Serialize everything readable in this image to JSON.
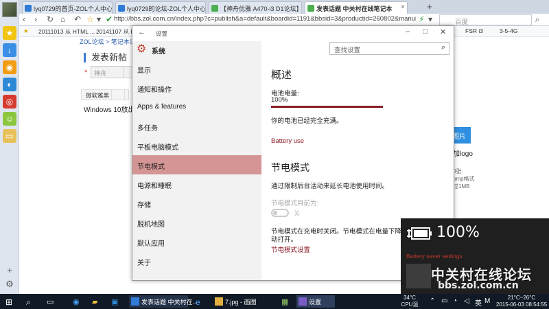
{
  "browser": {
    "tabs": [
      {
        "title": "lyq0729的首页-ZOL个人中心"
      },
      {
        "title": "lyq0729的论坛-ZOL个人中心"
      },
      {
        "title": "【神舟优雅 A470-i3 D1论坛】"
      },
      {
        "title": "发表话题 中关村在线笔记本"
      }
    ],
    "new_tab": "+",
    "url": "http://bbs.zol.com.cn/index.php?c=publish&a=default&boardid=1191&bbsid=3&productid=260802&manuid",
    "search_placeholder": "百度",
    "bookmarks": [
      "20111013 从 HTML ...",
      "20141107 从 IE",
      "FSR i3",
      "3-5-4G"
    ],
    "page": {
      "breadcrumb": "ZOL论坛 > 笔记本论坛",
      "title": "发表新帖",
      "select_placeholder": "神舟",
      "font_select": "微软雅黑",
      "body_text": "Windows 10放出更",
      "image_button": "图片",
      "right_texts": [
        "加logo",
        "0张",
        "bmp格式",
        "过1MB"
      ]
    }
  },
  "settings": {
    "window_title": "设置",
    "section": "系统",
    "search_placeholder": "查找设置",
    "nav": [
      {
        "label": "显示"
      },
      {
        "label": "通知和操作"
      },
      {
        "label": "Apps & features"
      },
      {
        "label": "多任务"
      },
      {
        "label": "平板电脑模式"
      },
      {
        "label": "节电模式",
        "active": true
      },
      {
        "label": "电源和睡眠"
      },
      {
        "label": "存储"
      },
      {
        "label": "脱机地图"
      },
      {
        "label": "默认应用"
      },
      {
        "label": "关于"
      }
    ],
    "overview_heading": "概述",
    "battery_label": "电池电量:",
    "battery_value": "100%",
    "battery_fraction": 1.0,
    "battery_status": "你的电池已经完全充满。",
    "battery_use_link": "Battery use",
    "saver_heading": "节电模式",
    "saver_description": "通过限制后台活动来延长电池使用时间。",
    "saver_status_label": "节电模式目前为:",
    "saver_toggle_state": "关",
    "saver_note_line1": "节电模式在充电时关闭。节电模式在电量下降到不",
    "saver_note_line2": "动打开。",
    "saver_settings_link": "节电模式设置"
  },
  "flyout": {
    "percent": "100%",
    "battery_saver_link": "Battery saver settings",
    "watermark_line1": "中关村在线论坛",
    "watermark_line2": "bbs.zol.com.cn"
  },
  "taskbar": {
    "apps": [
      {
        "label": "发表话题 中关村在..."
      },
      {
        "label": "7.jpg - 画图"
      },
      {
        "label": "设置"
      }
    ],
    "temp": "34°C",
    "temp_label": "CPU温度",
    "weather": "21°C~26°C",
    "ime": "英",
    "date": "2015-06-03",
    "time": "08:54:55"
  },
  "colors": {
    "accent": "#8b1c24",
    "nav_active": "#d59595",
    "taskbar": "#0f1a26"
  }
}
